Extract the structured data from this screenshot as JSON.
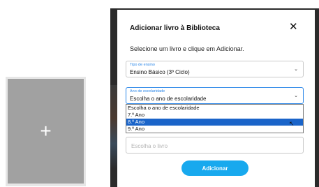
{
  "add_card": {
    "icon": "plus-icon",
    "glyph": "+"
  },
  "modal": {
    "title": "Adicionar livro à Biblioteca",
    "close_glyph": "✕",
    "instruction": "Selecione um livro e clique em Adicionar.",
    "tipo_ensino": {
      "caption": "Tipo de ensino",
      "value": "Ensino Básico (3º Ciclo)"
    },
    "ano_escolaridade": {
      "caption": "Ano de escolaridade",
      "value": "Escolha o ano de escolaridade",
      "options": [
        "Escolha o ano de escolaridade",
        "7.º Ano",
        "8.º Ano",
        "9.º Ano"
      ],
      "highlighted": "8.º Ano"
    },
    "livro": {
      "placeholder": "Escolha o livro"
    },
    "submit_label": "Adicionar"
  },
  "colors": {
    "accent": "#18a9ee",
    "selection": "#1a64c9",
    "caption": "#2a86e8"
  }
}
